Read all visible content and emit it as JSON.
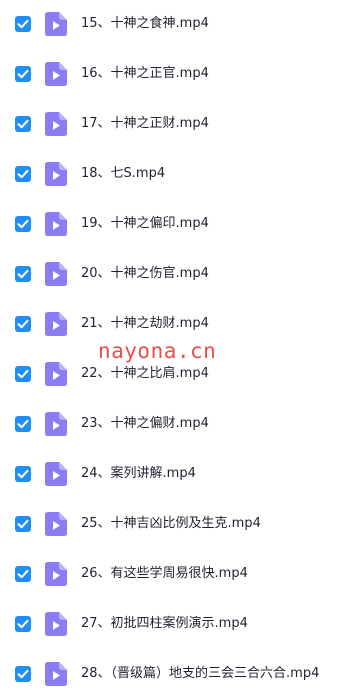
{
  "accent_color": "#1f8ff7",
  "file_icon_color": "#8a7cf2",
  "files": [
    {
      "name": "15、十神之食神.mp4",
      "checked": true,
      "icon": "video-file-icon"
    },
    {
      "name": "16、十神之正官.mp4",
      "checked": true,
      "icon": "video-file-icon"
    },
    {
      "name": "17、十神之正财.mp4",
      "checked": true,
      "icon": "video-file-icon"
    },
    {
      "name": "18、七S.mp4",
      "checked": true,
      "icon": "video-file-icon"
    },
    {
      "name": "19、十神之偏印.mp4",
      "checked": true,
      "icon": "video-file-icon"
    },
    {
      "name": "20、十神之伤官.mp4",
      "checked": true,
      "icon": "video-file-icon"
    },
    {
      "name": "21、十神之劫财.mp4",
      "checked": true,
      "icon": "video-file-icon"
    },
    {
      "name": "22、十神之比肩.mp4",
      "checked": true,
      "icon": "video-file-icon"
    },
    {
      "name": "23、十神之偏财.mp4",
      "checked": true,
      "icon": "video-file-icon"
    },
    {
      "name": "24、案列讲解.mp4",
      "checked": true,
      "icon": "video-file-icon"
    },
    {
      "name": "25、十神吉凶比例及生克.mp4",
      "checked": true,
      "icon": "video-file-icon"
    },
    {
      "name": "26、有这些学周易很快.mp4",
      "checked": true,
      "icon": "video-file-icon"
    },
    {
      "name": "27、初批四柱案例演示.mp4",
      "checked": true,
      "icon": "video-file-icon"
    },
    {
      "name": "28、（晋级篇）地支的三会三合六合.mp4",
      "checked": true,
      "icon": "video-file-icon"
    }
  ],
  "watermark": "nayona.cn"
}
